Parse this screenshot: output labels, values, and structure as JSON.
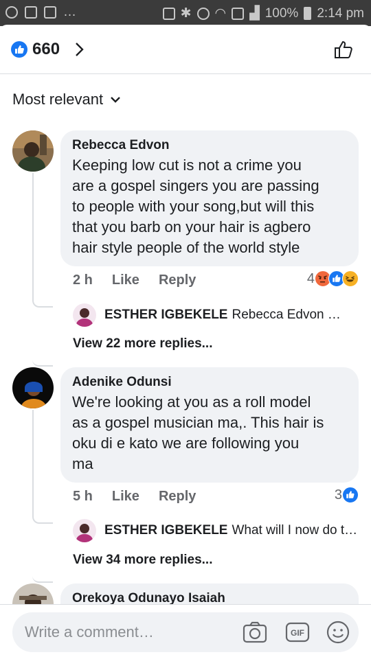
{
  "status_bar": {
    "battery": "100%",
    "time": "2:14 pm"
  },
  "reactions_header": {
    "count": "660"
  },
  "sort": {
    "label": "Most relevant"
  },
  "comments": [
    {
      "author": "Rebecca Edvon",
      "lines": [
        "Keeping low cut is not a crime you",
        "are a gospel singers you are passing",
        "to people with your song,but will this",
        "that you barb on your hair is agbero",
        "hair style people of the world style"
      ],
      "time": "2 h",
      "like_label": "Like",
      "reply_label": "Reply",
      "reaction_count": "4",
      "reactions": [
        "angry-icon",
        "like-icon",
        "haha-icon"
      ],
      "reply_preview": {
        "name": "ESTHER IGBEKELE",
        "text": "Rebecca Edvon  …"
      },
      "view_more": "View 22 more replies..."
    },
    {
      "author": "Adenike Odunsi",
      "lines": [
        "We're looking at you as a roll model",
        "as a gospel musician ma,. This hair is",
        "oku di e kato we are following you",
        "ma"
      ],
      "time": "5 h",
      "like_label": "Like",
      "reply_label": "Reply",
      "reaction_count": "3",
      "reactions": [
        "like-icon"
      ],
      "reply_preview": {
        "name": "ESTHER IGBEKELE",
        "text": "What will I now do t…"
      },
      "view_more": "View 34 more replies..."
    },
    {
      "author": "Orekoya Odunayo Isaiah"
    }
  ],
  "composer": {
    "placeholder": "Write a comment…"
  },
  "colors": {
    "facebook_blue": "#1877f2",
    "bubble_bg": "#f0f2f5",
    "meta_gray": "#65676b"
  }
}
